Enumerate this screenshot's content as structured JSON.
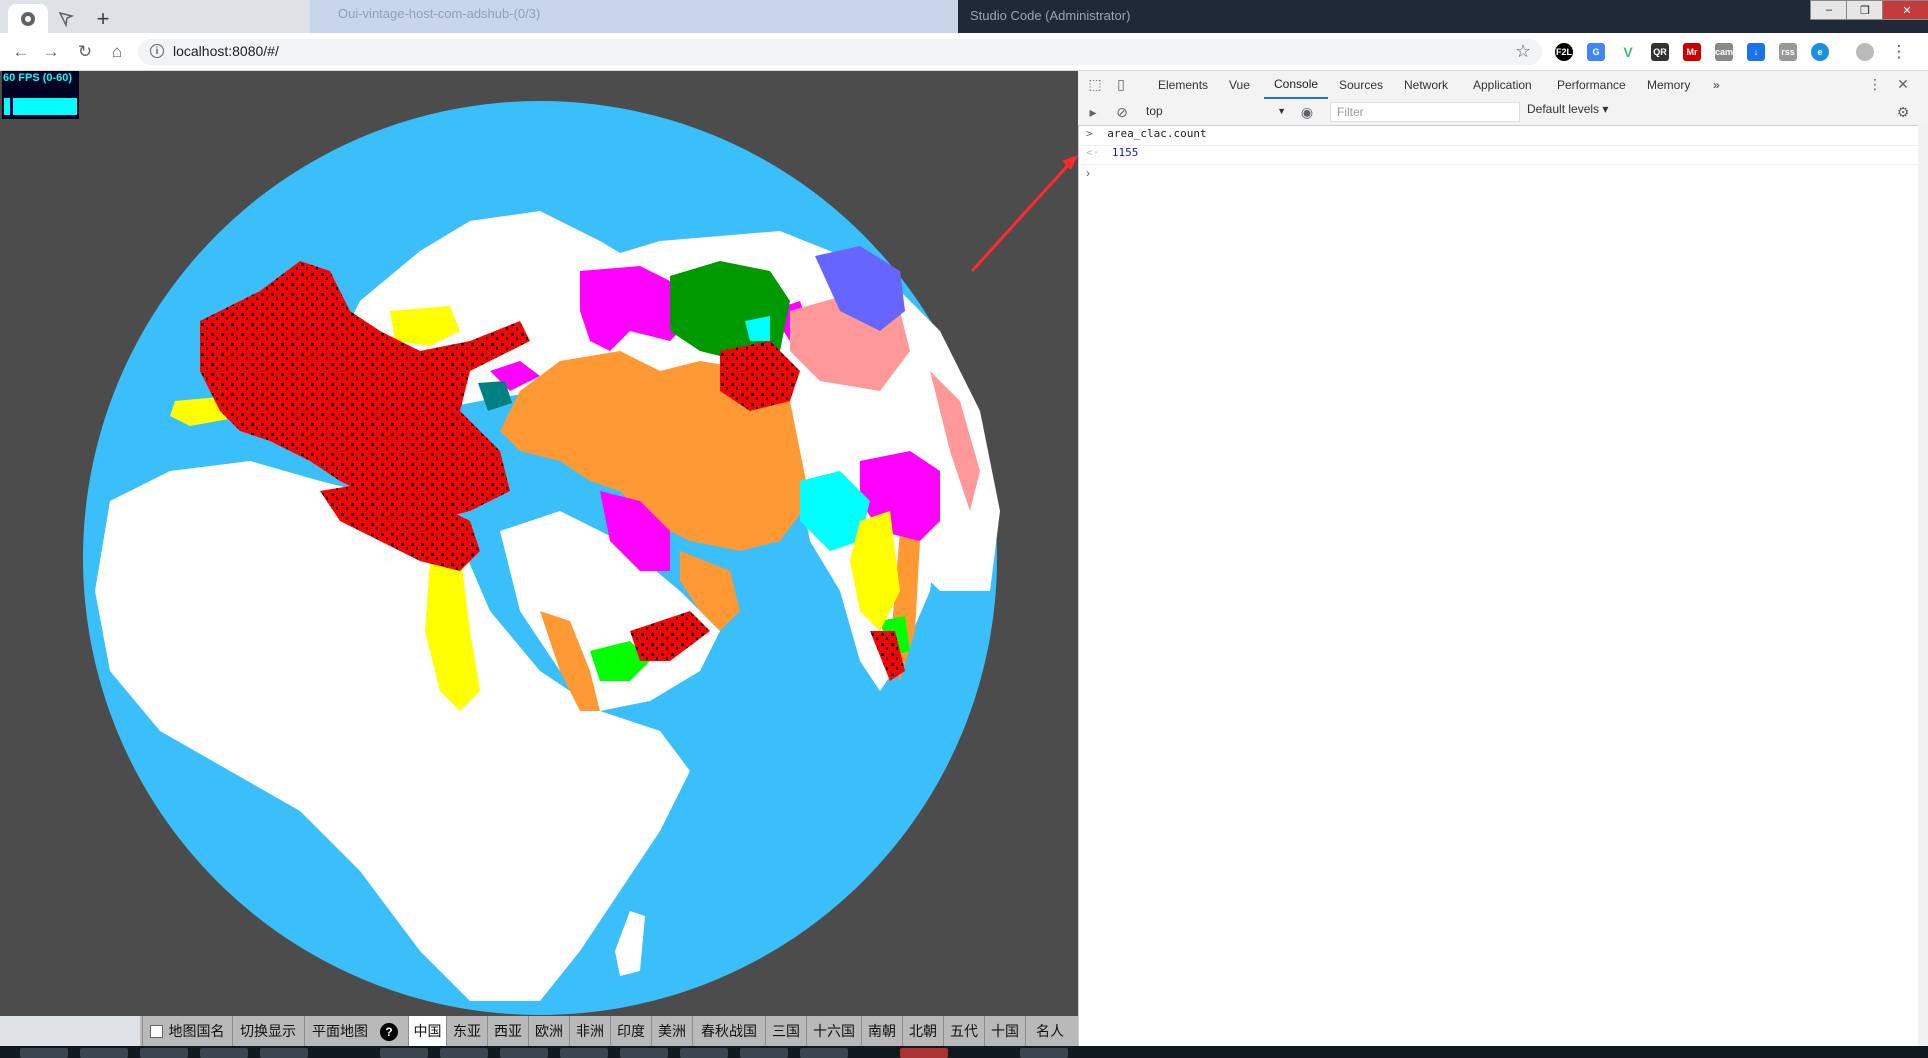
{
  "browser": {
    "url": "localhost:8080/#/",
    "background_window_title": "Oui-vintage-host-com-adshub-(0/3)",
    "right_window_title": "Studio Code (Administrator)",
    "window_buttons": [
      "–",
      "❐",
      "✕"
    ],
    "extensions": [
      "F2L",
      "G",
      "V",
      "QR",
      "Mr",
      "cam",
      "↓",
      "rss",
      "e"
    ]
  },
  "fps_meter": {
    "label": "60 FPS (0-60)",
    "fps": 60,
    "range": [
      0,
      60
    ]
  },
  "bottom_bar": {
    "toggle_label": "地图国名",
    "buttons": [
      "切换显示",
      "平面地图"
    ],
    "help": "?",
    "eras": [
      "中国",
      "东亚",
      "西亚",
      "欧洲",
      "非洲",
      "印度",
      "美洲",
      "春秋战国",
      "三国",
      "十六国",
      "南朝",
      "北朝",
      "五代",
      "十国",
      "名人"
    ],
    "selected_era": "中国"
  },
  "devtools": {
    "tabs": [
      "Elements",
      "Vue",
      "Console",
      "Sources",
      "Network",
      "Application",
      "Performance",
      "Memory"
    ],
    "more": "»",
    "active_tab": "Console",
    "context": "top",
    "filter_placeholder": "Filter",
    "levels": "Default levels ▾",
    "console": [
      {
        "prompt": ">",
        "text": "area_clac.count"
      },
      {
        "prompt": "<·",
        "text": "1155"
      }
    ]
  },
  "colors": {
    "ocean": "#3bbffa",
    "land": "#ffffff",
    "empire_red": "#ff0000",
    "persia_orange": "#ff9933",
    "magenta": "#ff00ff",
    "green": "#009900",
    "yellow": "#ffff00",
    "cyan": "#00ffff",
    "pink": "#ff9999",
    "purple_blue": "#6666ff",
    "lime": "#00ff00",
    "teal": "#008080",
    "annotation_arrow": "#ff2a2a"
  }
}
